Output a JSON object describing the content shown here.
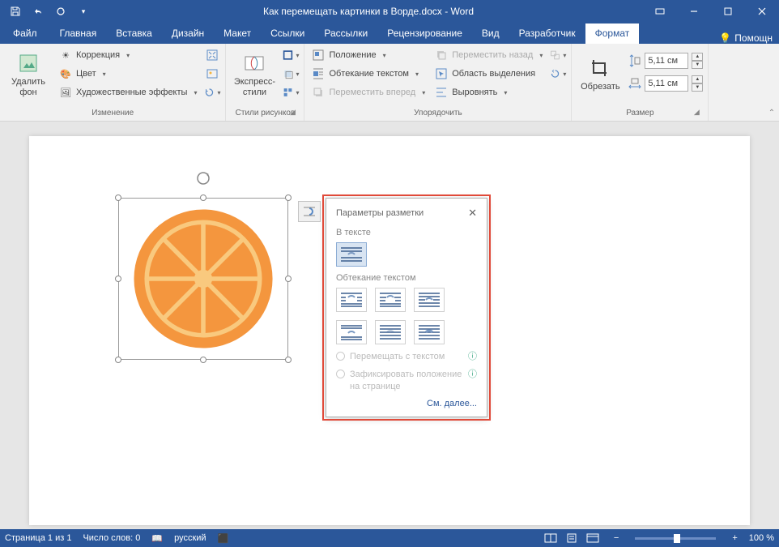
{
  "title": "Как перемещать картинки в Ворде.docx - Word",
  "tabs": {
    "file": "Файл",
    "home": "Главная",
    "insert": "Вставка",
    "design": "Дизайн",
    "layout": "Макет",
    "references": "Ссылки",
    "mailings": "Рассылки",
    "review": "Рецензирование",
    "view": "Вид",
    "developer": "Разработчик",
    "format": "Формат",
    "help": "Помощн"
  },
  "ribbon": {
    "remove_bg": "Удалить фон",
    "corrections": "Коррекция",
    "color": "Цвет",
    "artistic": "Художественные эффекты",
    "group_adjust": "Изменение",
    "express_styles": "Экспресс-стили",
    "group_styles": "Стили рисунков",
    "position": "Положение",
    "wrap_text": "Обтекание текстом",
    "bring_forward": "Переместить вперед",
    "send_backward": "Переместить назад",
    "selection_pane": "Область выделения",
    "align": "Выровнять",
    "group_arrange": "Упорядочить",
    "crop": "Обрезать",
    "height": "5,11 см",
    "width": "5,11 см",
    "group_size": "Размер"
  },
  "flyout": {
    "title": "Параметры разметки",
    "inline_label": "В тексте",
    "wrap_label": "Обтекание текстом",
    "move_with_text": "Перемещать с текстом",
    "fix_position": "Зафиксировать положение на странице",
    "see_more": "См. далее..."
  },
  "status": {
    "page": "Страница 1 из 1",
    "words": "Число слов: 0",
    "language": "русский",
    "zoom": "100 %"
  }
}
